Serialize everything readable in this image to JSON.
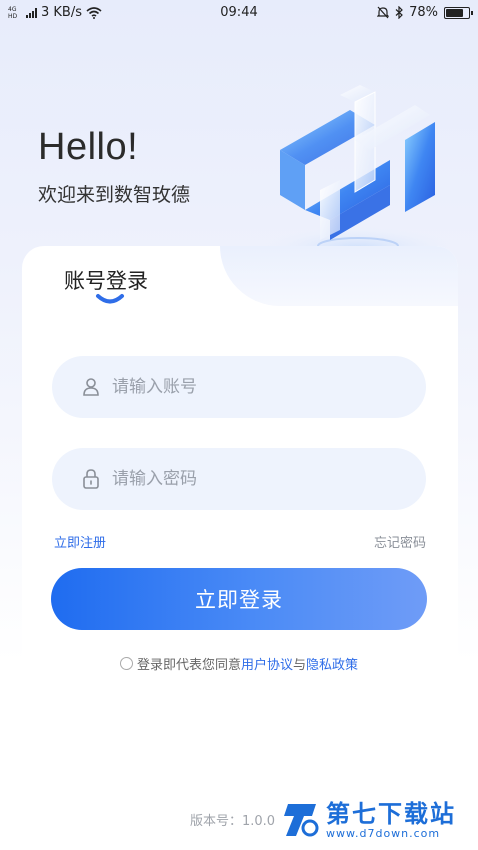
{
  "status_bar": {
    "network_label": "4G HD",
    "speed": "3 KB/s",
    "time": "09:44",
    "battery": "78%",
    "battery_level": 0.78,
    "icons": [
      "signal-icon",
      "wifi-icon",
      "mute-icon",
      "bluetooth-icon",
      "battery-icon"
    ]
  },
  "hero": {
    "greeting": "Hello!",
    "welcome": "欢迎来到数智玫德"
  },
  "login": {
    "tab_title": "账号登录",
    "username_placeholder": "请输入账号",
    "password_placeholder": "请输入密码",
    "register_link": "立即注册",
    "forgot_link": "忘记密码",
    "submit_label": "立即登录",
    "agreement_prefix": "登录即代表您同意",
    "user_agreement": "用户协议",
    "agreement_and": "与",
    "privacy_policy": "隐私政策"
  },
  "footer": {
    "version": "版本号：1.0.0"
  },
  "watermark": {
    "title": "第七下载站",
    "url": "www.d7down.com"
  },
  "colors": {
    "accent": "#2f6de8",
    "button_start": "#1f6cf0",
    "button_end": "#6f9cf7",
    "field_bg": "#eef3fd"
  }
}
